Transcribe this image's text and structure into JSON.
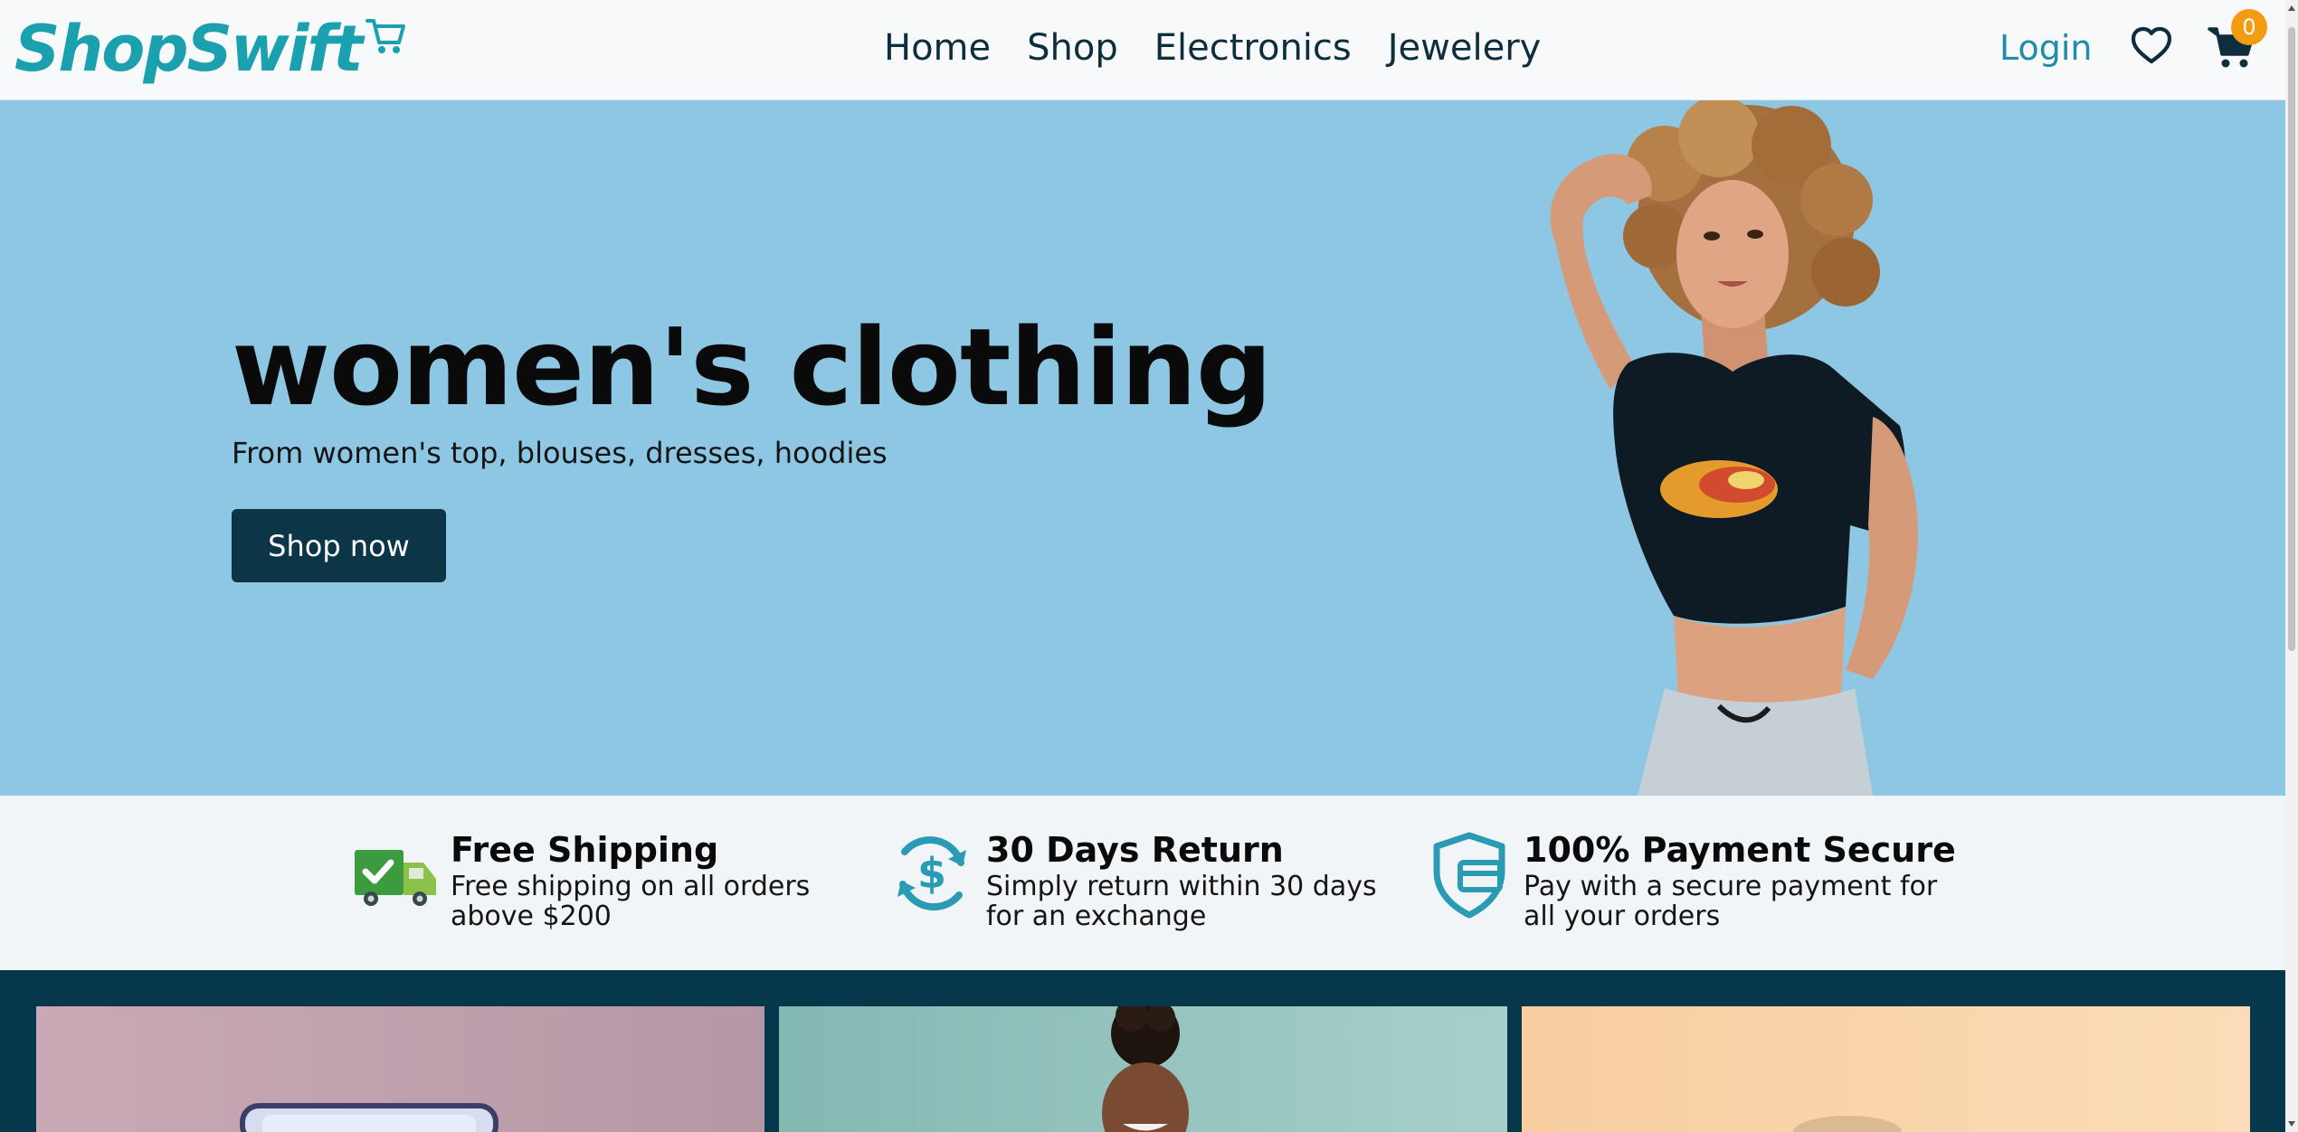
{
  "header": {
    "logo_text": "ShopSwift",
    "nav": [
      "Home",
      "Shop",
      "Electronics",
      "Jewelery"
    ],
    "login_label": "Login",
    "cart_count": "0"
  },
  "hero": {
    "title": "women's clothing",
    "subtitle": "From women's top, blouses, dresses, hoodies",
    "cta_label": "Shop now"
  },
  "features": [
    {
      "title": "Free Shipping",
      "desc_line1": "Free shipping on all orders",
      "desc_line2": "above $200",
      "icon": "truck-icon"
    },
    {
      "title": "30 Days Return",
      "desc_line1": "Simply return within 30 days",
      "desc_line2": "for an exchange",
      "icon": "money-return-icon"
    },
    {
      "title": "100% Payment Secure",
      "desc_line1": "Pay with a secure payment for",
      "desc_line2": "all your orders",
      "icon": "secure-payment-icon"
    }
  ],
  "colors": {
    "brand": "#1aa0ae",
    "hero_bg": "#8ec7e3",
    "button_dark": "#0c3547",
    "strip_bg": "#07374a",
    "badge": "#f39c12"
  }
}
